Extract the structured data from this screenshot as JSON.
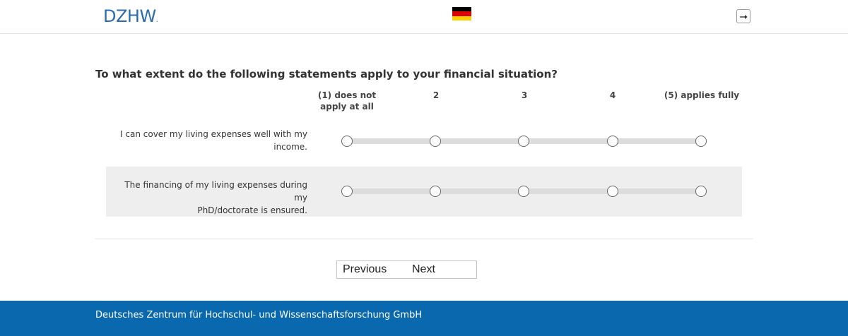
{
  "header": {
    "logo_text": "DZHW",
    "logo_dot": ".",
    "flag_colors": [
      "#000000",
      "#dd0000",
      "#ffce00"
    ],
    "flag_icon": "german-flag-icon",
    "exit_icon": "logout-icon"
  },
  "question": {
    "text": "To what extent do the following statements apply to your financial situation?"
  },
  "scale": {
    "options": [
      {
        "label_line1": "(1) does not",
        "label_line2": "apply at all"
      },
      {
        "label_line1": "2",
        "label_line2": ""
      },
      {
        "label_line1": "3",
        "label_line2": ""
      },
      {
        "label_line1": "4",
        "label_line2": ""
      },
      {
        "label_line1": "(5) applies fully",
        "label_line2": ""
      }
    ]
  },
  "items": [
    {
      "line1": "I can cover my living expenses well with my",
      "line2": "income.",
      "selected": null
    },
    {
      "line1": "The financing of my living expenses during my",
      "line2": "PhD/doctorate is ensured.",
      "selected": null
    }
  ],
  "nav": {
    "previous_label": "Previous",
    "next_label": "Next"
  },
  "footer": {
    "text": "Deutsches Zentrum für Hochschul- und Wissenschaftsforschung GmbH"
  },
  "colors": {
    "brand_blue": "#2a6db2",
    "footer_blue": "#0a68ae",
    "row_alt": "#eeeeee"
  }
}
